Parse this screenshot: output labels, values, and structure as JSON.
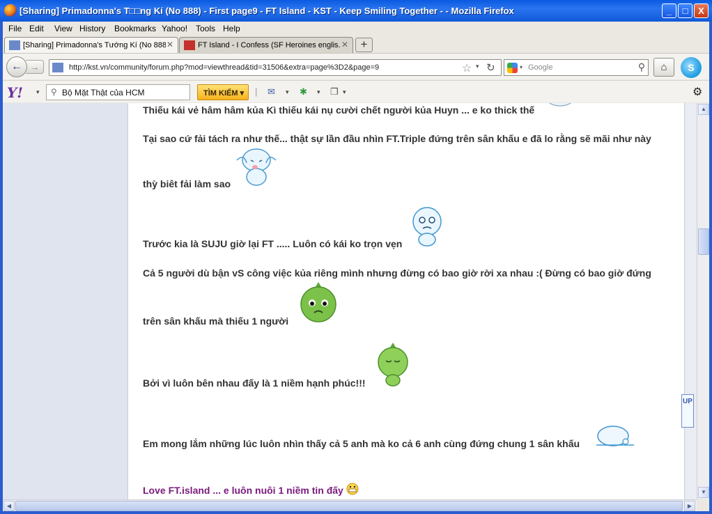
{
  "window": {
    "title": "[Sharing] Primadonna's T□□ng Kí (No 888) - First page9 - FT Island - KST - Keep Smiling Together - - Mozilla Firefox",
    "minimize": "_",
    "maximize": "□",
    "close": "X"
  },
  "menu": [
    "File",
    "Edit",
    "View",
    "History",
    "Bookmarks",
    "Yahoo!",
    "Tools",
    "Help"
  ],
  "tabs": [
    {
      "label": "[Sharing] Primadonna's Tướng Kí (No 888...",
      "close": "✕"
    },
    {
      "label": "FT Island - I Confess (SF Heroines englis...",
      "close": "✕"
    }
  ],
  "newtab": "+",
  "nav": {
    "url": "http://kst.vn/community/forum.php?mod=viewthread&tid=31506&extra=page%3D2&page=9",
    "search_placeholder": "Google",
    "back": "←",
    "forward": "→",
    "star": "☆",
    "dropdown": "▾",
    "reload": "↻",
    "search_icon": "⚲",
    "home": "⌂",
    "skype": "S"
  },
  "yahoo": {
    "logo": "Y!",
    "dropdown": "▾",
    "search_value": "Bộ Mặt Thật của HCM",
    "button_label": "TÌM KIẾM ▾",
    "mail_icon": "✉",
    "separator": "|",
    "plus_icon": "✱",
    "page_icon": "❐",
    "settings": "⚙"
  },
  "post": {
    "lines": [
      "Thiếu kái vẻ hâm hâm kủa Kì thiếu kái nụ cười chết người kủa Huyn ... e ko thick thế",
      "Tại sao cứ fải tách ra như thế... thật sự lần đầu nhìn FT.Triple đứng trên sân khấu e đã lo rằng sẽ mãi như này",
      "thỳ biêt fải làm sao",
      "Trước kia là SUJU giờ lại FT ..... Luôn có kái ko trọn vẹn",
      "Cả 5 người dù bận vS công việc kủa riêng mình nhưng đừng có bao giờ rời xa nhau :( Đừng có bao giờ đứng",
      "trên sân khấu mà thiếu 1 người",
      "Bởi vì luôn bên nhau đấy là 1 niềm hạnh phúc!!!",
      "Em mong lắm những lúc luôn nhìn thấy cả 5 anh mà ko cả 6 anh cùng đứng chung 1 sân khấu",
      "Love FT.island ... e luôn nuôi 1 niềm tin đấy"
    ]
  },
  "scroll": {
    "up_label": "UP",
    "arrow_up": "▲",
    "arrow_down": "▼",
    "arrow_left": "◀",
    "arrow_right": "▶"
  }
}
